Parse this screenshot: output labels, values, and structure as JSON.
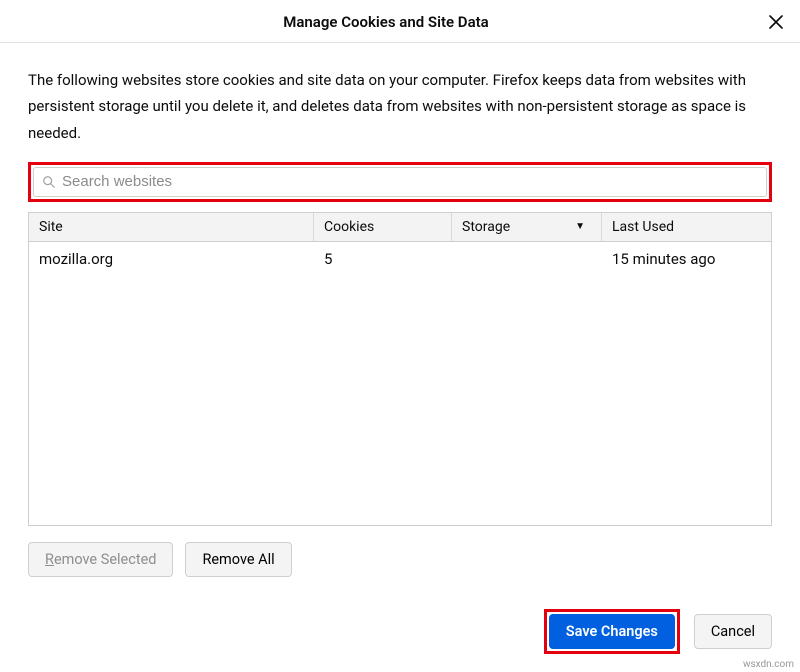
{
  "dialog": {
    "title": "Manage Cookies and Site Data",
    "description": "The following websites store cookies and site data on your computer. Firefox keeps data from websites with persistent storage until you delete it, and deletes data from websites with non-persistent storage as space is needed."
  },
  "search": {
    "placeholder": "Search websites",
    "value": ""
  },
  "table": {
    "columns": {
      "site": "Site",
      "cookies": "Cookies",
      "storage": "Storage",
      "last_used": "Last Used"
    },
    "sort_indicator": "▼",
    "rows": [
      {
        "site": "mozilla.org",
        "cookies": "5",
        "storage": "",
        "last_used": "15 minutes ago"
      }
    ]
  },
  "buttons": {
    "remove_selected": "Remove Selected",
    "remove_all": "Remove All",
    "save_changes": "Save Changes",
    "cancel": "Cancel"
  },
  "watermark": "wsxdn.com"
}
